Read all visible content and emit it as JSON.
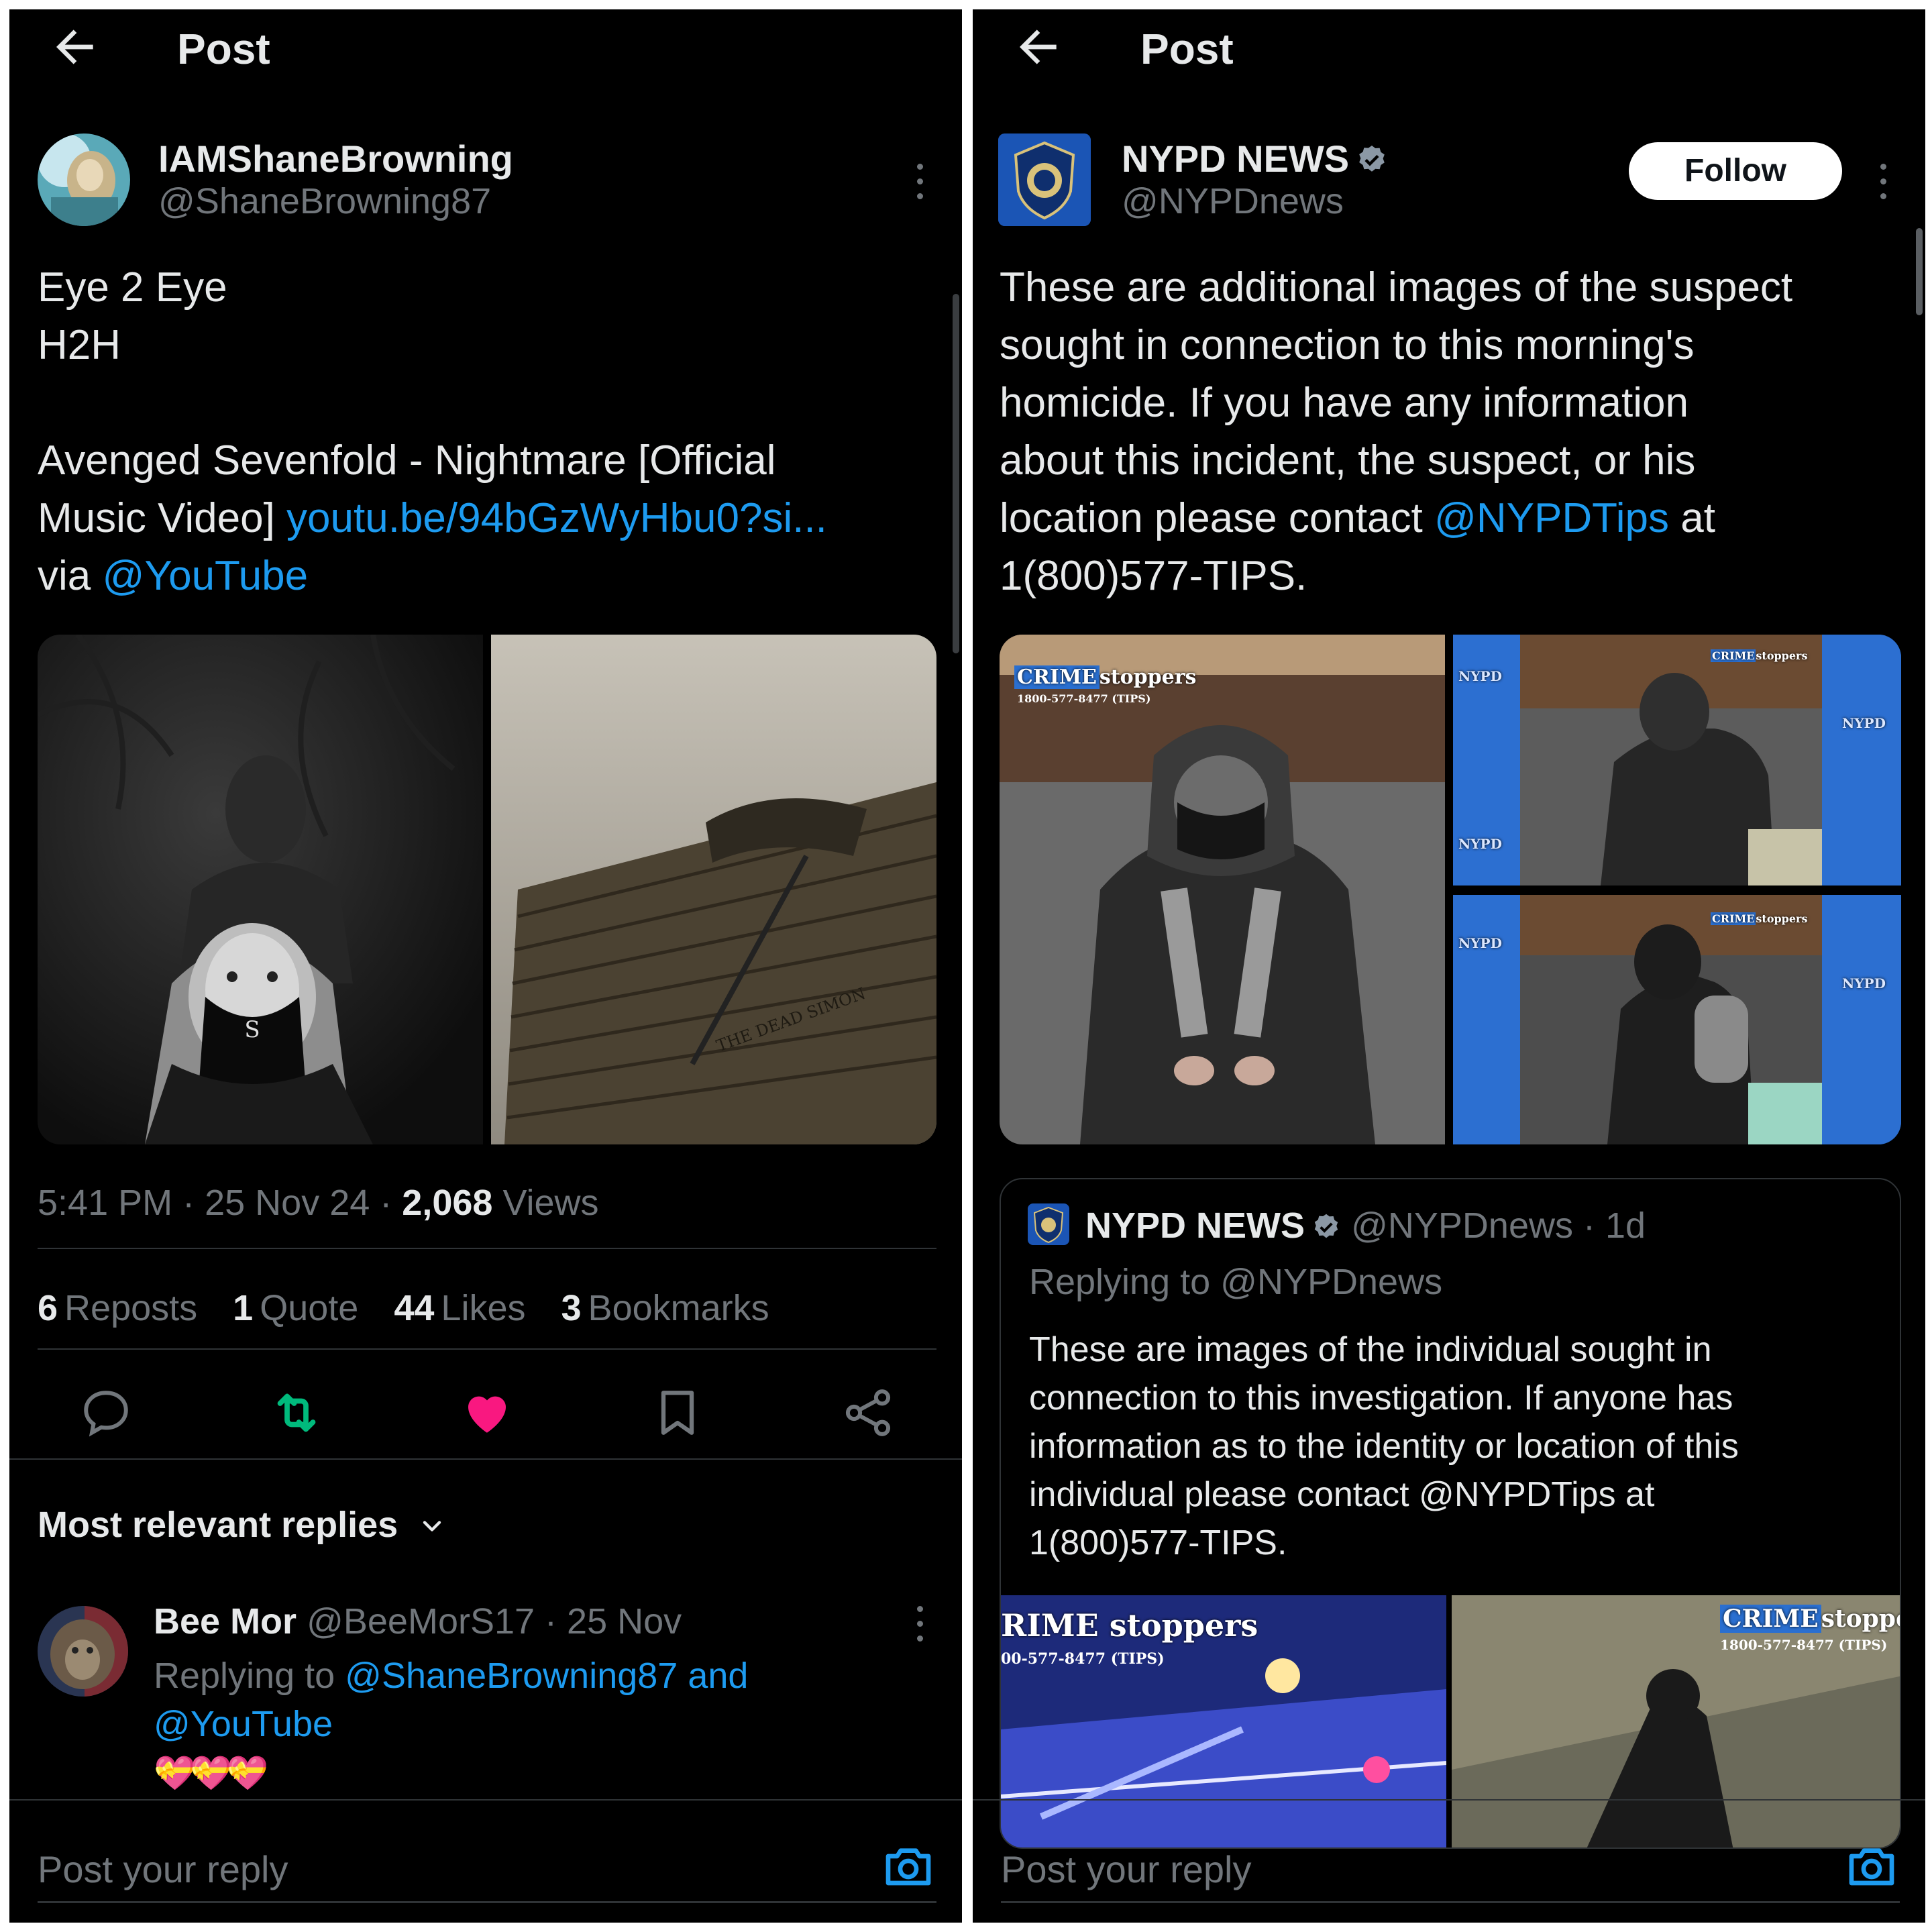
{
  "left": {
    "topbar": {
      "title": "Post"
    },
    "author": {
      "name": "IAMShaneBrowning",
      "handle": "@ShaneBrowning87"
    },
    "post": {
      "line1": "Eye 2 Eye",
      "line2": "H2H",
      "line3": "Avenged Sevenfold - Nightmare [Official",
      "line4_prefix": "Music Video] ",
      "link": "youtu.be/94bGzWyHbu0?si...",
      "via": "via ",
      "mention": "@YouTube"
    },
    "media": {
      "image2_inscription": "THE DEAD SIMON"
    },
    "meta": {
      "time": "5:41 PM",
      "date": "25 Nov 24",
      "views_count": "2,068",
      "views_label": "Views",
      "sep": " · "
    },
    "stats": [
      {
        "count": "6",
        "label": "Reposts"
      },
      {
        "count": "1",
        "label": "Quote"
      },
      {
        "count": "44",
        "label": "Likes"
      },
      {
        "count": "3",
        "label": "Bookmarks"
      }
    ],
    "actions": [
      "reply-icon",
      "repost-icon",
      "like-icon",
      "bookmark-icon",
      "share-icon"
    ],
    "colors": {
      "repost": "#00ba7c",
      "like": "#f91880",
      "link": "#1d9bf0"
    },
    "replies_sort": "Most relevant replies",
    "reply": {
      "name": "Bee Mor",
      "handle": "@BeeMorS17",
      "date": "25 Nov",
      "replying_prefix": "Replying to ",
      "replying_mentions_1": "@ShaneBrowning87 and",
      "replying_mentions_2": "@YouTube",
      "emoji": "💝💝💝"
    },
    "reply_input": {
      "placeholder": "Post your reply"
    }
  },
  "right": {
    "topbar": {
      "title": "Post"
    },
    "author": {
      "name": "NYPD NEWS",
      "handle": "@NYPDnews",
      "follow": "Follow"
    },
    "post": {
      "line1": "These are additional images of the suspect",
      "line2": "sought in connection to this morning's",
      "line3": "homicide. If you have any information",
      "line4": "about this incident, the suspect, or his",
      "line5_prefix": "location please contact ",
      "line5_mention": "@NYPDTips",
      "line5_suffix": " at",
      "line6": "1(800)577-TIPS."
    },
    "media": {
      "crime_label_prefix": "CRIME",
      "crime_label_suffix": "stoppers",
      "crime_phone": "1800-577-8477 (TIPS)",
      "nypd_tag_top": "NYPD",
      "tile_word": "NYPD",
      "tile_word_short": "NY"
    },
    "quote": {
      "name": "NYPD NEWS",
      "handle": "@NYPDnews",
      "age": "1d",
      "sep": " · ",
      "replying": "Replying to @NYPDnews",
      "line1": "These are images of the individual sought in",
      "line2": "connection to this investigation. If anyone has",
      "line3": "information as to the identity or location of this",
      "line4": "individual please contact @NYPDTips at",
      "line5": "1(800)577-TIPS.",
      "media_left_label": "RIME stoppers",
      "media_left_phone": "00-577-8477 (TIPS)",
      "media_right_label_prefix": "CRIME",
      "media_right_label_suffix": "stoppers",
      "media_right_phone": "1800-577-8477 (TIPS)"
    },
    "reply_input": {
      "placeholder": "Post your reply"
    },
    "colors": {
      "verified": "#8b98a5",
      "follow_bg": "#ffffff"
    }
  }
}
